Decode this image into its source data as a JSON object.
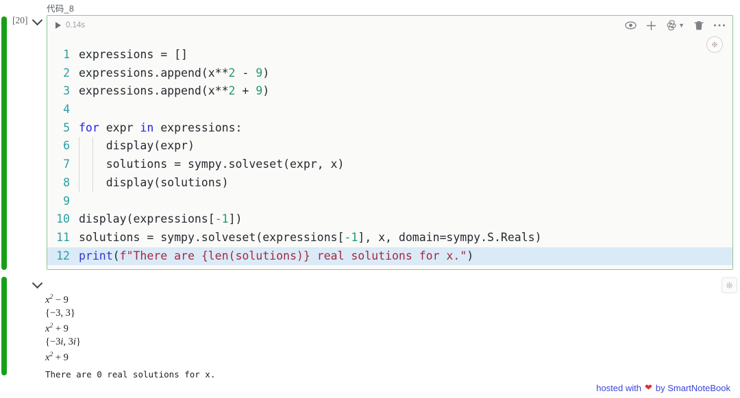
{
  "cell": {
    "label": "代码_8",
    "execution_count": "[20]",
    "run_time": "0.14s",
    "collapse_icon": "chevron-down-icon",
    "play_icon": "play-triangle-icon",
    "kernel_badge_glyph": "❉",
    "toolbar": [
      {
        "name": "eye-icon",
        "glyph": "◉",
        "title": "Hide output"
      },
      {
        "name": "plus-icon",
        "glyph": "＋",
        "title": "Add cell"
      },
      {
        "name": "python-kernel-icon",
        "glyph": "🐍",
        "title": "Kernel"
      },
      {
        "name": "chevron-down-icon",
        "glyph": "▾",
        "title": "Kernel menu"
      },
      {
        "name": "trash-icon",
        "glyph": "🗑",
        "title": "Delete cell"
      },
      {
        "name": "more-options-icon",
        "glyph": "⋯",
        "title": "More"
      }
    ]
  },
  "code": {
    "highlight_line": 12,
    "lines": [
      {
        "n": "1",
        "guides": 0,
        "tokens": [
          {
            "t": "expressions = []"
          }
        ]
      },
      {
        "n": "2",
        "guides": 0,
        "tokens": [
          {
            "t": "expressions.append(x**"
          },
          {
            "t": "2",
            "c": "tok-num"
          },
          {
            "t": " - "
          },
          {
            "t": "9",
            "c": "tok-num"
          },
          {
            "t": ")"
          }
        ]
      },
      {
        "n": "3",
        "guides": 0,
        "tokens": [
          {
            "t": "expressions.append(x**"
          },
          {
            "t": "2",
            "c": "tok-num"
          },
          {
            "t": " + "
          },
          {
            "t": "9",
            "c": "tok-num"
          },
          {
            "t": ")"
          }
        ]
      },
      {
        "n": "4",
        "guides": 0,
        "tokens": [
          {
            "t": ""
          }
        ]
      },
      {
        "n": "5",
        "guides": 0,
        "tokens": [
          {
            "t": "for",
            "c": "tok-kw"
          },
          {
            "t": " expr "
          },
          {
            "t": "in",
            "c": "tok-kw"
          },
          {
            "t": " expressions:"
          }
        ]
      },
      {
        "n": "6",
        "guides": 2,
        "tokens": [
          {
            "t": "    display(expr)"
          }
        ]
      },
      {
        "n": "7",
        "guides": 2,
        "tokens": [
          {
            "t": "    solutions = sympy.solveset(expr, x)"
          }
        ]
      },
      {
        "n": "8",
        "guides": 2,
        "tokens": [
          {
            "t": "    display(solutions)"
          }
        ]
      },
      {
        "n": "9",
        "guides": 0,
        "tokens": [
          {
            "t": ""
          }
        ]
      },
      {
        "n": "10",
        "guides": 0,
        "tokens": [
          {
            "t": "display(expressions["
          },
          {
            "t": "-1",
            "c": "tok-num"
          },
          {
            "t": "])"
          }
        ]
      },
      {
        "n": "11",
        "guides": 0,
        "tokens": [
          {
            "t": "solutions = sympy.solveset(expressions["
          },
          {
            "t": "-1",
            "c": "tok-num"
          },
          {
            "t": "], x, domain=sympy.S.Reals)"
          }
        ]
      },
      {
        "n": "12",
        "guides": 0,
        "tokens": [
          {
            "t": "print",
            "c": "tok-fn"
          },
          {
            "t": "("
          },
          {
            "t": "f\"There are {len(solutions)} real solutions for x.\"",
            "c": "tok-str"
          },
          {
            "t": ")"
          }
        ]
      }
    ]
  },
  "output": {
    "collapse_icon": "chevron-down-icon",
    "action_button": {
      "name": "clear-output-icon",
      "glyph": "❊"
    },
    "math": [
      {
        "base": "x",
        "exp": "2",
        "rest": " − 9"
      },
      {
        "plain": "{−3, 3}"
      },
      {
        "base": "x",
        "exp": "2",
        "rest": " + 9"
      },
      {
        "plain_i": "{−3i, 3i}"
      },
      {
        "base": "x",
        "exp": "2",
        "rest": " + 9"
      }
    ],
    "stdout": "There are 0 real solutions for x."
  },
  "footer": {
    "prefix": "hosted with",
    "heart": "❤",
    "suffix": "by SmartNoteBook"
  },
  "colors": {
    "selection_bar": "#17a017",
    "cell_border": "#8cc78c",
    "line_number": "#29a0a0",
    "keyword": "#2222dd",
    "number": "#1f9a6d",
    "string": "#a3293f",
    "highlight_line_bg": "#dbeaf7",
    "footer_text": "#3b44d8",
    "heart": "#e02b3c"
  }
}
